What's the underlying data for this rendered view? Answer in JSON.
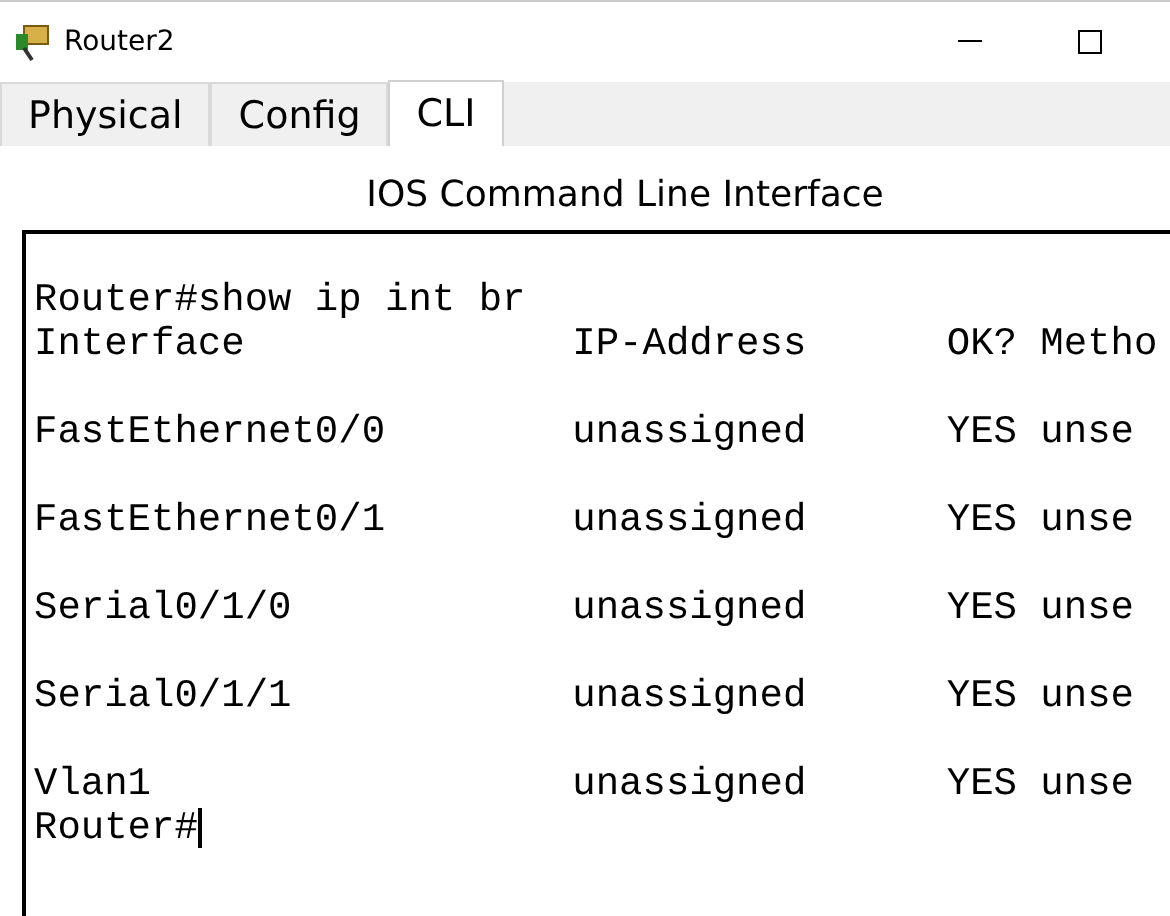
{
  "window": {
    "title": "Router2"
  },
  "tabs": [
    {
      "label": "Physical",
      "selected": false
    },
    {
      "label": "Config",
      "selected": false
    },
    {
      "label": "CLI",
      "selected": true
    }
  ],
  "heading": "IOS Command Line Interface",
  "terminal": {
    "lines": [
      {
        "kind": "command",
        "text": "Router#show ip int br"
      },
      {
        "kind": "header",
        "text": "Interface              IP-Address      OK? Metho"
      },
      {
        "kind": "row",
        "text": "FastEthernet0/0        unassigned      YES unse"
      },
      {
        "kind": "row",
        "text": "FastEthernet0/1        unassigned      YES unse"
      },
      {
        "kind": "row",
        "text": "Serial0/1/0            unassigned      YES unse"
      },
      {
        "kind": "row",
        "text": "Serial0/1/1            unassigned      YES unse"
      },
      {
        "kind": "row",
        "text": "Vlan1                  unassigned      YES unse"
      },
      {
        "kind": "prompt",
        "text": "Router#"
      }
    ]
  }
}
